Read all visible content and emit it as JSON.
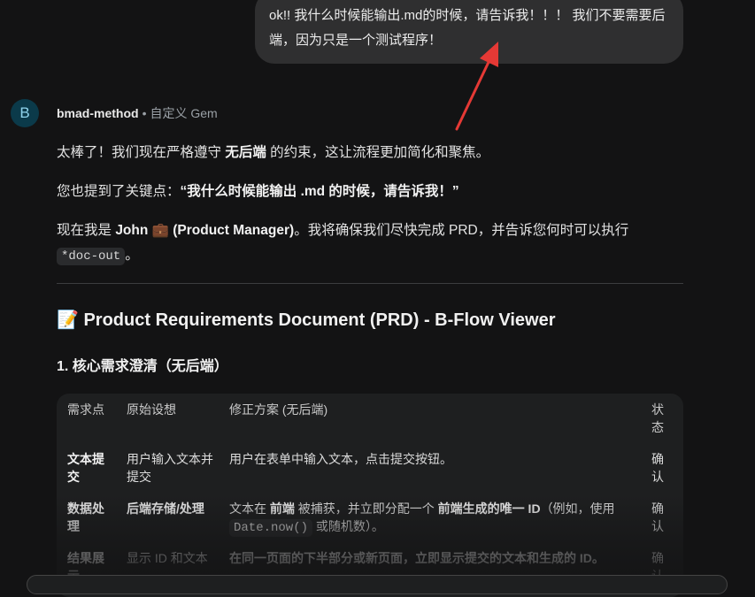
{
  "user_message": "ok!! 我什么时候能输出.md的时候，请告诉我！！！ 我们不要需要后端，因为只是一个测试程序！",
  "bot": {
    "avatar_letter": "B",
    "name": "bmad-method",
    "separator": "•",
    "tag": "自定义 Gem"
  },
  "response": {
    "p1_a": "太棒了！我们现在严格遵守 ",
    "p1_b": "无后端",
    "p1_c": " 的约束，这让流程更加简化和聚焦。",
    "p2_a": "您也提到了关键点：",
    "p2_b": "“我什么时候能输出 .md 的时候，请告诉我！”",
    "p3_a": "现在我是 ",
    "p3_b": "John 💼 (Product Manager)",
    "p3_c": "。我将确保我们尽快完成 PRD，并告诉您何时可以执行 ",
    "p3_code": "*doc-out",
    "p3_d": "。",
    "heading": "📝 Product Requirements Document (PRD) - B-Flow Viewer",
    "subheading": "1. 核心需求澄清（无后端）"
  },
  "table": {
    "headers": [
      "需求点",
      "原始设想",
      "修正方案 (无后端)",
      "状态"
    ],
    "rows": [
      {
        "c1": "文本提交",
        "c2": "用户输入文本并提交",
        "c3a": "用户在表单中输入文本，点击提交按钮。",
        "c4": "确认"
      },
      {
        "c1": "数据处理",
        "c2": "后端存储/处理",
        "c3a": "文本在 ",
        "c3b": "前端",
        "c3c": " 被捕获，并立即分配一个 ",
        "c3d": "前端生成的唯一 ID",
        "c3e": "（例如，使用 ",
        "c3code": "Date.now()",
        "c3f": " 或随机数）。",
        "c4": "确认"
      },
      {
        "c1": "结果展示",
        "c2": "显示 ID 和文本",
        "c3a": "在同一页面的下半部分或新页面，立即显示提交的文本和生成的 ID。",
        "c4": "确认"
      }
    ]
  },
  "colors": {
    "accent_arrow": "#e53935",
    "background": "#131314",
    "bubble": "#2f2f30"
  }
}
